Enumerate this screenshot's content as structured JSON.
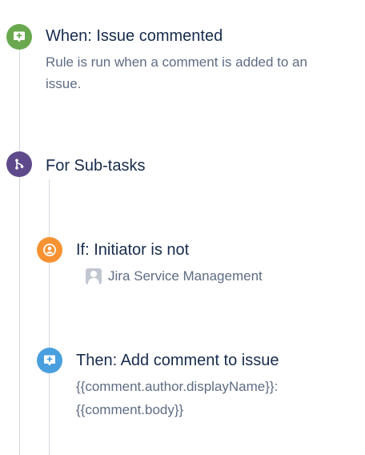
{
  "trigger": {
    "icon": "comment-add-icon",
    "color": "#6aa84f",
    "title": "When: Issue commented",
    "description": "Rule is run when a comment is added to an issue."
  },
  "branch": {
    "icon": "branch-icon",
    "color": "#5e4a8b",
    "title": "For Sub-tasks"
  },
  "condition": {
    "icon": "user-circle-icon",
    "color": "#f79232",
    "title": "If: Initiator is not",
    "user_name": "Jira Service Management"
  },
  "action": {
    "icon": "comment-add-icon",
    "color": "#4a9fde",
    "title": "Then: Add comment to issue",
    "line1": "{{comment.author.displayName}}:",
    "line2": "{{comment.body}}"
  }
}
